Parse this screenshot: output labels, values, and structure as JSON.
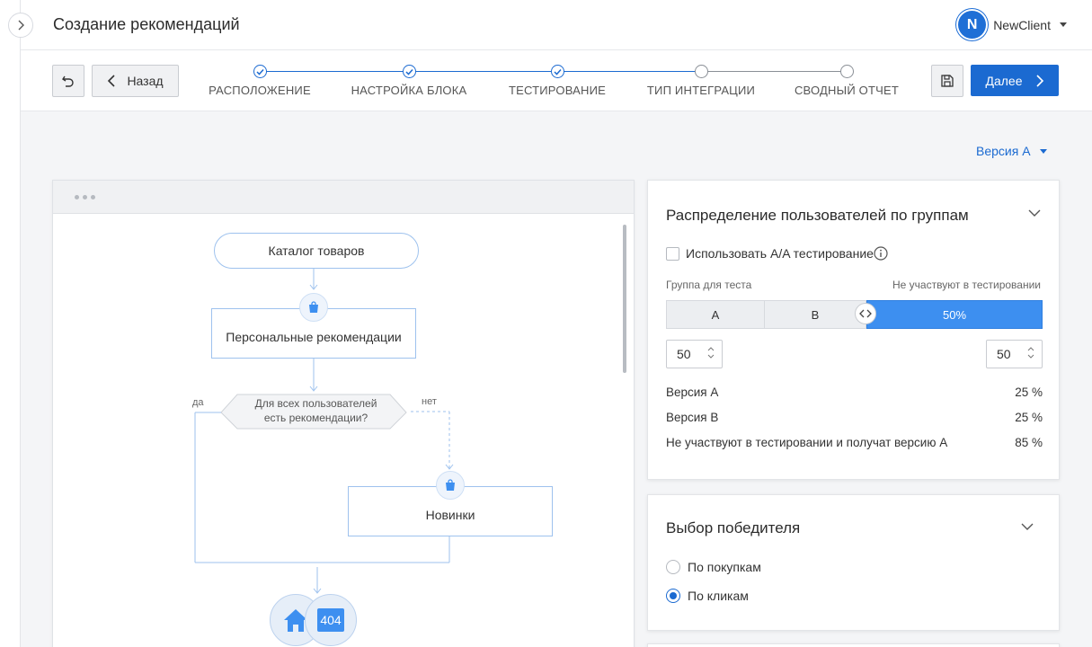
{
  "header": {
    "title": "Создание рекомендаций",
    "user": {
      "initial": "N",
      "name": "NewClient"
    }
  },
  "toolbar": {
    "back_label": "Назад",
    "next_label": "Далее"
  },
  "steps": [
    {
      "label": "РАСПОЛОЖЕНИЕ",
      "done": true
    },
    {
      "label": "НАСТРОЙКА БЛОКА",
      "done": true
    },
    {
      "label": "ТЕСТИРОВАНИЕ",
      "done": true
    },
    {
      "label": "ТИП ИНТЕГРАЦИИ",
      "done": false
    },
    {
      "label": "СВОДНЫЙ ОТЧЕТ",
      "done": false
    }
  ],
  "version_select": "Версия А",
  "flow": {
    "catalog": "Каталог товаров",
    "personal": "Персональные рекомендации",
    "decision_line1": "Для всех пользователей",
    "decision_line2": "есть рекомендации?",
    "yes": "да",
    "no": "нет",
    "new_items": "Новинки",
    "end_badge": "404"
  },
  "distribution": {
    "title": "Распределение пользователей по группам",
    "aa_label": "Использовать A/A тестирование",
    "aa_checked": false,
    "test_group_label": "Группа для теста",
    "not_participating_label": "Не участвуют в тестировании",
    "seg_a": "A",
    "seg_b": "B",
    "seg_rest": "50%",
    "input_left": "50",
    "input_right": "50",
    "rows": [
      {
        "label": "Версия A",
        "value": "25 %"
      },
      {
        "label": "Версия B",
        "value": "25 %"
      },
      {
        "label": "Не участвуют в тестировании и получат версию A",
        "value": "85 %"
      }
    ]
  },
  "winner": {
    "title": "Выбор победителя",
    "options": [
      {
        "label": "По покупкам",
        "selected": false
      },
      {
        "label": "По кликам",
        "selected": true
      }
    ]
  },
  "colors": {
    "accent": "#1b6ad1",
    "bar": "#3d8ff0",
    "flow_line": "#9ec2ee"
  },
  "icons": [
    "chevron-right-icon",
    "undo-icon",
    "chevron-left-icon",
    "check-icon",
    "floppy-disk-icon",
    "caret-down-icon",
    "shopping-bag-icon",
    "home-icon",
    "info-icon",
    "chevron-down-icon"
  ]
}
